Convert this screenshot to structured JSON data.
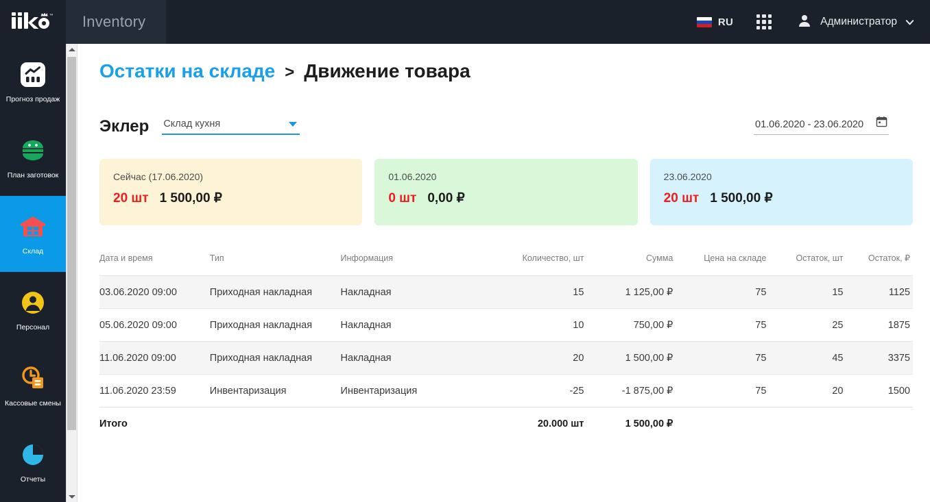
{
  "header": {
    "logo_alt": "iiko",
    "app_tab": "Inventory",
    "language": "RU",
    "apps_icon": "apps-grid-icon",
    "user": "Администратор",
    "chevron": "chevron-down-icon"
  },
  "sidebar": {
    "items": [
      {
        "label": "Прогноз продаж",
        "icon": "sales-forecast-icon",
        "active": false
      },
      {
        "label": "План заготовок",
        "icon": "prep-plan-icon",
        "active": false
      },
      {
        "label": "Склад",
        "icon": "warehouse-icon",
        "active": true
      },
      {
        "label": "Персонал",
        "icon": "staff-icon",
        "active": false
      },
      {
        "label": "Кассовые смены",
        "icon": "cash-shifts-icon",
        "active": false
      },
      {
        "label": "Отчеты",
        "icon": "reports-icon",
        "active": false
      }
    ]
  },
  "breadcrumb": {
    "parent": "Остатки на складе",
    "separator": ">",
    "current": "Движение товара"
  },
  "filters": {
    "product": "Эклер",
    "store_value": "Склад кухня",
    "store_arrow": "chevron-down-icon",
    "date_range": "01.06.2020 - 23.06.2020",
    "calendar_icon": "calendar-icon"
  },
  "cards": [
    {
      "date": "Сейчас (17.06.2020)",
      "qty": "20 шт",
      "sum": "1 500,00 ₽",
      "bg": "#fdf3d7"
    },
    {
      "date": "01.06.2020",
      "qty": "0 шт",
      "sum": "0,00 ₽",
      "bg": "#d9f7d9"
    },
    {
      "date": "23.06.2020",
      "qty": "20 шт",
      "sum": "1 500,00 ₽",
      "bg": "#d6f2fc"
    }
  ],
  "table": {
    "columns": [
      "Дата и время",
      "Тип",
      "Информация",
      "Количество, шт",
      "Сумма",
      "Цена на складе",
      "Остаток, шт",
      "Остаток, ₽"
    ],
    "rows": [
      {
        "datetime": "03.06.2020 09:00",
        "type": "Приходная накладная",
        "info": "Накладная",
        "qty": "15",
        "sum": "1 125,00 ₽",
        "price": "75",
        "rest_qty": "15",
        "rest_sum": "1125"
      },
      {
        "datetime": "05.06.2020 09:00",
        "type": "Приходная накладная",
        "info": "Накладная",
        "qty": "10",
        "sum": "750,00 ₽",
        "price": "75",
        "rest_qty": "25",
        "rest_sum": "1875"
      },
      {
        "datetime": "11.06.2020 09:00",
        "type": "Приходная накладная",
        "info": "Накладная",
        "qty": "20",
        "sum": "1 500,00 ₽",
        "price": "75",
        "rest_qty": "45",
        "rest_sum": "3375"
      },
      {
        "datetime": "11.06.2020 23:59",
        "type": "Инвентаризация",
        "info": "Инвентаризация",
        "qty": "-25",
        "sum": "-1 875,00 ₽",
        "price": "75",
        "rest_qty": "20",
        "rest_sum": "1500"
      }
    ],
    "total": {
      "label": "Итого",
      "qty": "20.000 шт",
      "sum": "1 500,00 ₽"
    }
  },
  "colors": {
    "accent": "#0b9ae8",
    "link": "#1aa0e8",
    "danger": "#ef1d1d",
    "header_bg": "#1b212a",
    "tab_bg": "#242c37"
  }
}
